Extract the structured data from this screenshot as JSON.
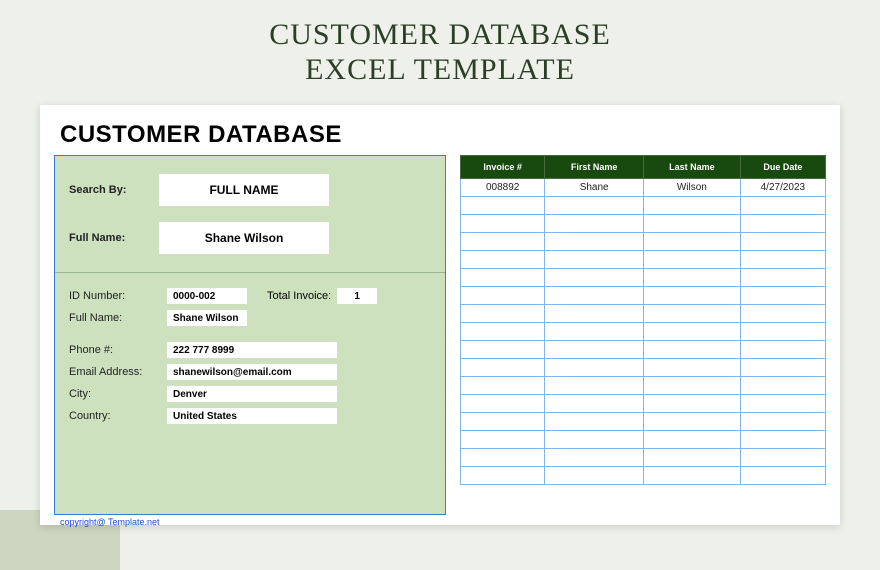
{
  "page_title_line1": "CUSTOMER DATABASE",
  "page_title_line2": "EXCEL TEMPLATE",
  "doc_title": "CUSTOMER DATABASE",
  "search": {
    "search_by_label": "Search By:",
    "search_by_value": "FULL NAME",
    "full_name_label": "Full Name:",
    "full_name_value": "Shane Wilson"
  },
  "details": {
    "id_number_label": "ID Number:",
    "id_number_value": "0000-002",
    "total_invoice_label": "Total Invoice:",
    "total_invoice_value": "1",
    "full_name_label": "Full Name:",
    "full_name_value": "Shane Wilson",
    "phone_label": "Phone #:",
    "phone_value": "222 777 8999",
    "email_label": "Email Address:",
    "email_value": "shanewilson@email.com",
    "city_label": "City:",
    "city_value": "Denver",
    "country_label": "Country:",
    "country_value": "United States"
  },
  "table": {
    "headers": {
      "invoice": "Invoice #",
      "first_name": "First Name",
      "last_name": "Last Name",
      "due_date": "Due Date"
    },
    "row1": {
      "invoice": "008892",
      "first_name": "Shane",
      "last_name": "Wilson",
      "due_date": "4/27/2023"
    }
  },
  "copyright": "copyright@ Template.net"
}
